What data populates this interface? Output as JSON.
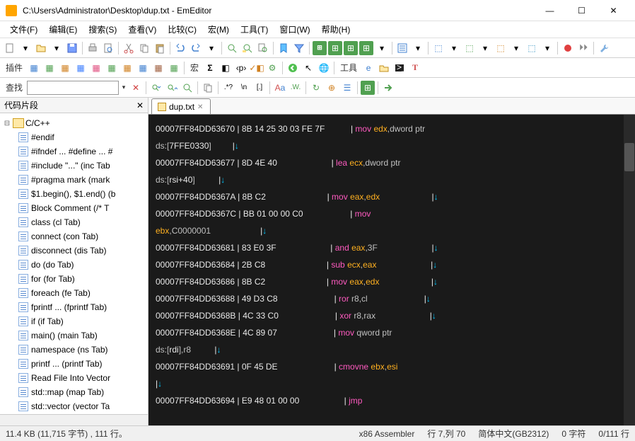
{
  "window": {
    "title": "C:\\Users\\Administrator\\Desktop\\dup.txt - EmEditor"
  },
  "menu": {
    "items": [
      "文件(F)",
      "编辑(E)",
      "搜索(S)",
      "查看(V)",
      "比较(C)",
      "宏(M)",
      "工具(T)",
      "窗口(W)",
      "帮助(H)"
    ]
  },
  "toolbar2": {
    "label_plugins": "插件",
    "label_macro": "宏",
    "label_tools": "工具"
  },
  "find": {
    "label": "查找",
    "placeholder": ""
  },
  "sidebar": {
    "title": "代码片段",
    "root": "C/C++",
    "items": [
      "#endif",
      "#ifndef ... #define ... #",
      "#include \"...\"  (inc Tab",
      "#pragma mark  (mark",
      "$1.begin(), $1.end()  (b",
      "Block Comment  (/* T",
      "class  (cl Tab)",
      "connect  (con Tab)",
      "disconnect  (dis Tab)",
      "do  (do Tab)",
      "for  (for Tab)",
      "foreach  (fe Tab)",
      "fprintf ...  (fprintf Tab)",
      "if  (if Tab)",
      "main()  (main Tab)",
      "namespace  (ns Tab)",
      "printf ...  (printf Tab)",
      "Read File Into Vector",
      "std::map  (map Tab)",
      "std::vector  (vector Ta"
    ]
  },
  "tab": {
    "name": "dup.txt"
  },
  "code_lines": [
    [
      [
        "addr",
        "00007FF84DD63670 "
      ],
      [
        "bar",
        "| "
      ],
      [
        "hex",
        "8B 14 25 30 03 FE 7F           "
      ],
      [
        "bar",
        "| "
      ],
      [
        "mnem",
        "mov "
      ],
      [
        "reg",
        "edx"
      ],
      [
        "dim",
        ",dword ptr "
      ]
    ],
    [
      [
        "dim",
        "ds:["
      ],
      [
        "hex",
        "7FFE0330"
      ],
      [
        "dim",
        "]         "
      ],
      [
        "bar",
        "|"
      ],
      [
        "arrow",
        "↓"
      ]
    ],
    [
      [
        "addr",
        "00007FF84DD63677 "
      ],
      [
        "bar",
        "| "
      ],
      [
        "hex",
        "8D 4E 40                       "
      ],
      [
        "bar",
        "| "
      ],
      [
        "mnem",
        "lea "
      ],
      [
        "reg",
        "ecx"
      ],
      [
        "dim",
        ",dword ptr "
      ]
    ],
    [
      [
        "dim",
        "ds:["
      ],
      [
        "hex",
        "rsi+40"
      ],
      [
        "dim",
        "]          "
      ],
      [
        "bar",
        "|"
      ],
      [
        "arrow",
        "↓"
      ]
    ],
    [
      [
        "addr",
        "00007FF84DD6367A "
      ],
      [
        "bar",
        "| "
      ],
      [
        "hex",
        "8B C2                          "
      ],
      [
        "bar",
        "| "
      ],
      [
        "mnem",
        "mov "
      ],
      [
        "reg",
        "eax"
      ],
      [
        "dim",
        ","
      ],
      [
        "reg",
        "edx"
      ],
      [
        "dim",
        "                      "
      ],
      [
        "bar",
        "|"
      ],
      [
        "arrow",
        "↓"
      ]
    ],
    [
      [
        "addr",
        "00007FF84DD6367C "
      ],
      [
        "bar",
        "| "
      ],
      [
        "hex",
        "BB 01 00 00 C0                    "
      ],
      [
        "bar",
        "| "
      ],
      [
        "mnem",
        "mov "
      ]
    ],
    [
      [
        "reg",
        "ebx"
      ],
      [
        "dim",
        ",C0000001                     "
      ],
      [
        "bar",
        "|"
      ],
      [
        "arrow",
        "↓"
      ]
    ],
    [
      [
        "addr",
        "00007FF84DD63681 "
      ],
      [
        "bar",
        "| "
      ],
      [
        "hex",
        "83 E0 3F                       "
      ],
      [
        "bar",
        "| "
      ],
      [
        "mnem",
        "and "
      ],
      [
        "reg",
        "eax"
      ],
      [
        "dim",
        ",3F                       "
      ],
      [
        "bar",
        "|"
      ],
      [
        "arrow",
        "↓"
      ]
    ],
    [
      [
        "addr",
        "00007FF84DD63684 "
      ],
      [
        "bar",
        "| "
      ],
      [
        "hex",
        "2B C8                          "
      ],
      [
        "bar",
        "| "
      ],
      [
        "mnem",
        "sub "
      ],
      [
        "reg",
        "ecx"
      ],
      [
        "dim",
        ","
      ],
      [
        "reg",
        "eax"
      ],
      [
        "dim",
        "                       "
      ],
      [
        "bar",
        "|"
      ],
      [
        "arrow",
        "↓"
      ]
    ],
    [
      [
        "addr",
        "00007FF84DD63686 "
      ],
      [
        "bar",
        "| "
      ],
      [
        "hex",
        "8B C2                          "
      ],
      [
        "bar",
        "| "
      ],
      [
        "mnem",
        "mov "
      ],
      [
        "reg",
        "eax"
      ],
      [
        "dim",
        ","
      ],
      [
        "reg",
        "edx"
      ],
      [
        "dim",
        "                      "
      ],
      [
        "bar",
        "|"
      ],
      [
        "arrow",
        "↓"
      ]
    ],
    [
      [
        "addr",
        "00007FF84DD63688 "
      ],
      [
        "bar",
        "| "
      ],
      [
        "hex",
        "49 D3 C8                        "
      ],
      [
        "bar",
        "| "
      ],
      [
        "mnem",
        "ror "
      ],
      [
        "dim",
        "r8,cl                        "
      ],
      [
        "bar",
        "|"
      ],
      [
        "arrow",
        "↓"
      ]
    ],
    [
      [
        "addr",
        "00007FF84DD6368B "
      ],
      [
        "bar",
        "| "
      ],
      [
        "hex",
        "4C 33 C0                        "
      ],
      [
        "bar",
        "| "
      ],
      [
        "mnem",
        "xor "
      ],
      [
        "dim",
        "r8,rax                       "
      ],
      [
        "bar",
        "|"
      ],
      [
        "arrow",
        "↓"
      ]
    ],
    [
      [
        "addr",
        "00007FF84DD6368E "
      ],
      [
        "bar",
        "| "
      ],
      [
        "hex",
        "4C 89 07                        "
      ],
      [
        "bar",
        "| "
      ],
      [
        "mnem",
        "mov "
      ],
      [
        "dim",
        "qword ptr "
      ]
    ],
    [
      [
        "dim",
        "ds:["
      ],
      [
        "hex",
        "rdi"
      ],
      [
        "dim",
        "],r8          "
      ],
      [
        "bar",
        "|"
      ],
      [
        "arrow",
        "↓"
      ]
    ],
    [
      [
        "addr",
        "00007FF84DD63691 "
      ],
      [
        "bar",
        "| "
      ],
      [
        "hex",
        "0F 45 DE                        "
      ],
      [
        "bar",
        "| "
      ],
      [
        "mnem",
        "cmovne "
      ],
      [
        "reg",
        "ebx"
      ],
      [
        "dim",
        ","
      ],
      [
        "reg",
        "esi"
      ],
      [
        "dim",
        "                   "
      ]
    ],
    [
      [
        "bar",
        "|"
      ],
      [
        "arrow",
        "↓"
      ]
    ],
    [
      [
        "addr",
        "00007FF84DD63694 "
      ],
      [
        "bar",
        "| "
      ],
      [
        "hex",
        "E9 48 01 00 00                   "
      ],
      [
        "bar",
        "| "
      ],
      [
        "mnem",
        "jmp "
      ]
    ]
  ],
  "status": {
    "size": "11.4 KB (11,715 字节) , 111 行。",
    "lang": "x86 Assembler",
    "pos": "行 7,列 70",
    "enc": "简体中文(GB2312)",
    "sel": "0 字符",
    "lines": "0/111 行"
  }
}
